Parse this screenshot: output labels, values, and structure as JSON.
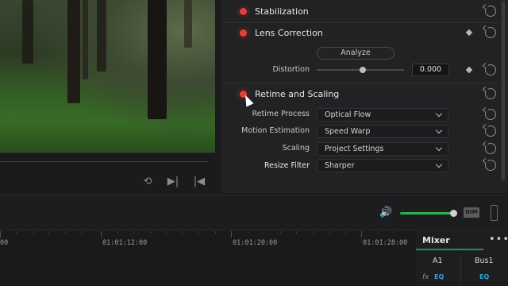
{
  "inspector": {
    "sections": {
      "stabilization": "Stabilization",
      "lens_correction": "Lens Correction",
      "retime": "Retime and Scaling"
    },
    "lens": {
      "analyze_label": "Analyze",
      "distortion_label": "Distortion",
      "distortion_value": "0.000"
    },
    "retime": {
      "process_label": "Retime Process",
      "process_value": "Optical Flow",
      "motion_label": "Motion Estimation",
      "motion_value": "Speed Warp",
      "scaling_label": "Scaling",
      "scaling_value": "Project Settings",
      "resize_label": "Resize Filter",
      "resize_value": "Sharper"
    }
  },
  "audio": {
    "dim_label": "DIM",
    "volume_level": 0.95
  },
  "timeline": {
    "timecodes": [
      "00",
      "01:01:12:00",
      "01:01:20:00",
      "01:01:28:00"
    ]
  },
  "mixer": {
    "title": "Mixer",
    "channels": [
      "A1",
      "Bus1"
    ],
    "fx_label": "fx",
    "eq_label": "EQ"
  },
  "colors": {
    "accent_green": "#29b34a",
    "enable_red": "#e2403d",
    "mixer_tab": "#1f8f5d"
  }
}
